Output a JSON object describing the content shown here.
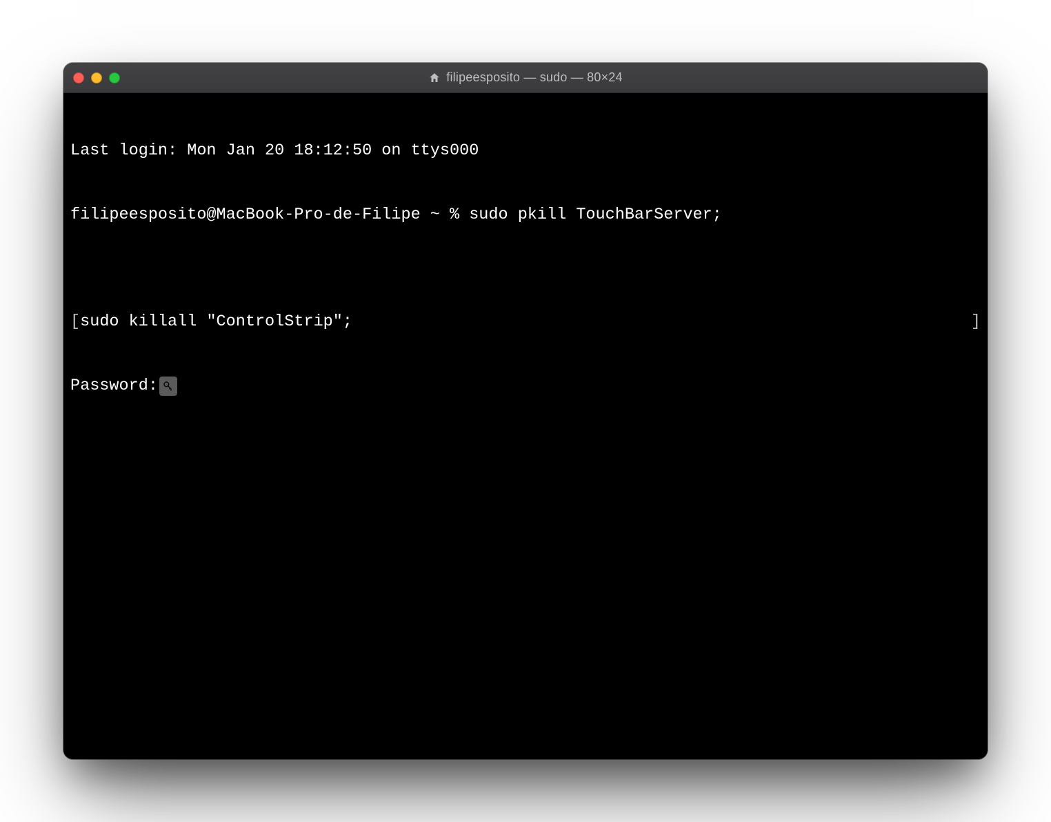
{
  "titlebar": {
    "title": "filipeesposito — sudo — 80×24",
    "icon": "home-icon"
  },
  "traffic_lights": {
    "close": "close",
    "minimize": "minimize",
    "maximize": "maximize"
  },
  "terminal": {
    "last_login": "Last login: Mon Jan 20 18:12:50 on ttys000",
    "prompt_line": "filipeesposito@MacBook-Pro-de-Filipe ~ % sudo pkill TouchBarServer;",
    "blank_line": "",
    "bracket_open": "[",
    "bracket_content": "sudo killall \"ControlStrip\";",
    "bracket_close": "]",
    "password_label": "Password:",
    "key_icon": "key-icon"
  }
}
